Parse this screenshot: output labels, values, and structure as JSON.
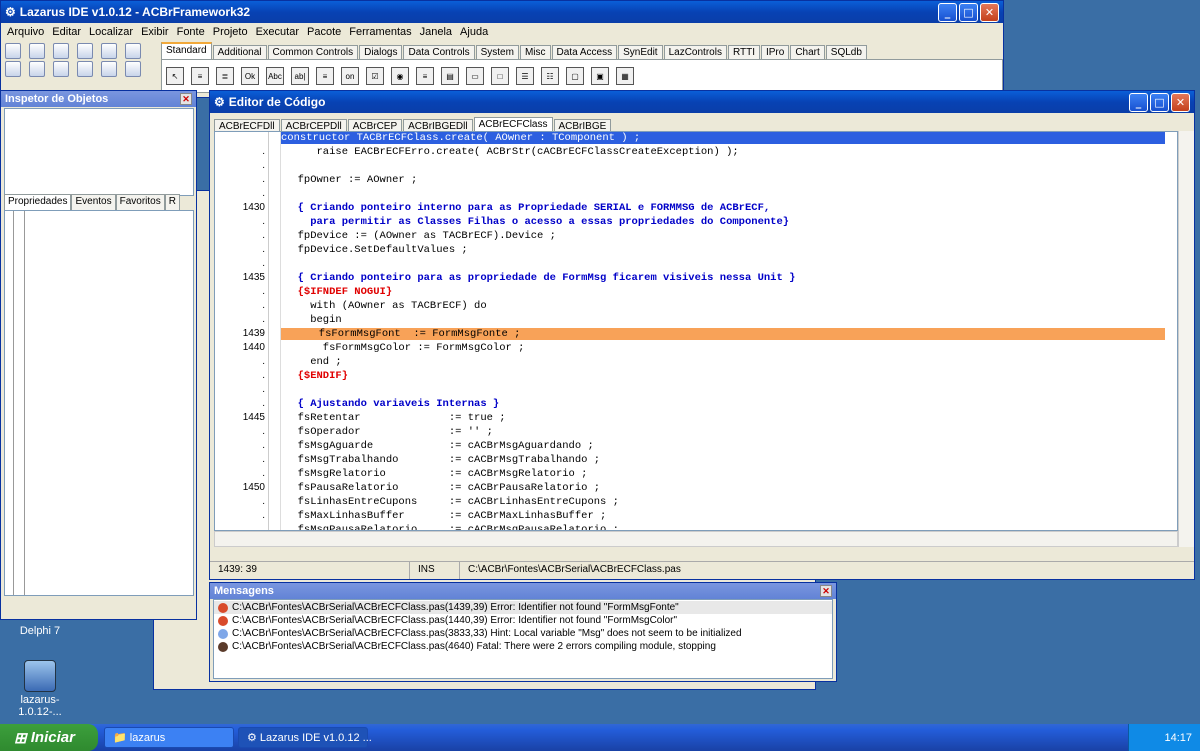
{
  "main_window": {
    "title": "Lazarus IDE v1.0.12 - ACBrFramework32",
    "menu": [
      "Arquivo",
      "Editar",
      "Localizar",
      "Exibir",
      "Fonte",
      "Projeto",
      "Executar",
      "Pacote",
      "Ferramentas",
      "Janela",
      "Ajuda"
    ],
    "palette_tabs": [
      "Standard",
      "Additional",
      "Common Controls",
      "Dialogs",
      "Data Controls",
      "System",
      "Misc",
      "Data Access",
      "SynEdit",
      "LazControls",
      "RTTI",
      "IPro",
      "Chart",
      "SQLdb"
    ],
    "active_palette_tab": "Standard"
  },
  "inspector": {
    "title": "Inspetor de Objetos",
    "tabs": [
      "Propriedades",
      "Eventos",
      "Favoritos",
      "R"
    ]
  },
  "desktop": {
    "icons": [
      {
        "label": "Delphi 7"
      },
      {
        "label": "lazarus-1.0.12-..."
      }
    ]
  },
  "editor": {
    "title": "Editor de Código",
    "tabs": [
      "ACBrECFDll",
      "ACBrCEPDll",
      "ACBrCEP",
      "ACBrIBGEDll",
      "ACBrECFClass",
      "ACBrIBGE"
    ],
    "active_tab": "ACBrECFClass",
    "lines": [
      {
        "n": "",
        "t": "constructor TACBrECFClass.create( AOwner : TComponent ) ;",
        "k": "sel"
      },
      {
        "n": ".",
        "t": "     raise EACBrECFErro.create( ACBrStr(cACBrECFClassCreateException) );",
        "k": ""
      },
      {
        "n": ".",
        "t": "",
        "k": ""
      },
      {
        "n": ".",
        "t": "  fpOwner := AOwner ;",
        "k": ""
      },
      {
        "n": ".",
        "t": "",
        "k": ""
      },
      {
        "n": "1430",
        "t": "  { Criando ponteiro interno para as Propriedade SERIAL e FORMMSG de ACBrECF,",
        "k": "cmt"
      },
      {
        "n": ".",
        "t": "    para permitir as Classes Filhas o acesso a essas propriedades do Componente}",
        "k": "cmt"
      },
      {
        "n": ".",
        "t": "  fpDevice := (AOwner as TACBrECF).Device ;",
        "k": ""
      },
      {
        "n": ".",
        "t": "  fpDevice.SetDefaultValues ;",
        "k": ""
      },
      {
        "n": ".",
        "t": "",
        "k": ""
      },
      {
        "n": "1435",
        "t": "  { Criando ponteiro para as propriedade de FormMsg ficarem visiveis nessa Unit }",
        "k": "cmt"
      },
      {
        "n": ".",
        "t": "  {$IFNDEF NOGUI}",
        "k": "dir"
      },
      {
        "n": ".",
        "t": "    with (AOwner as TACBrECF) do",
        "k": ""
      },
      {
        "n": ".",
        "t": "    begin",
        "k": ""
      },
      {
        "n": "1439",
        "t": "      fsFormMsgFont  := FormMsgFonte ;",
        "k": "err"
      },
      {
        "n": "1440",
        "t": "      fsFormMsgColor := FormMsgColor ;",
        "k": ""
      },
      {
        "n": ".",
        "t": "    end ;",
        "k": ""
      },
      {
        "n": ".",
        "t": "  {$ENDIF}",
        "k": "dir"
      },
      {
        "n": ".",
        "t": "",
        "k": ""
      },
      {
        "n": ".",
        "t": "  { Ajustando variaveis Internas }",
        "k": "cmt"
      },
      {
        "n": "1445",
        "t": "  fsRetentar              := true ;",
        "k": ""
      },
      {
        "n": ".",
        "t": "  fsOperador              := '' ;",
        "k": ""
      },
      {
        "n": ".",
        "t": "  fsMsgAguarde            := cACBrMsgAguardando ;",
        "k": ""
      },
      {
        "n": ".",
        "t": "  fsMsgTrabalhando        := cACBrMsgTrabalhando ;",
        "k": ""
      },
      {
        "n": ".",
        "t": "  fsMsgRelatorio          := cACBrMsgRelatorio ;",
        "k": ""
      },
      {
        "n": "1450",
        "t": "  fsPausaRelatorio        := cACBrPausaRelatorio ;",
        "k": ""
      },
      {
        "n": ".",
        "t": "  fsLinhasEntreCupons     := cACBrLinhasEntreCupons ;",
        "k": ""
      },
      {
        "n": ".",
        "t": "  fsMaxLinhasBuffer       := cACBrMaxLinhasBuffer ;",
        "k": ""
      },
      {
        "n": ".",
        "t": "  fsMsgPausaRelatorio     := cACBrMsgPausaRelatorio ;",
        "k": ""
      }
    ],
    "status": {
      "pos": "1439: 39",
      "mode": "INS",
      "file": "C:\\ACBr\\Fontes\\ACBrSerial\\ACBrECFClass.pas"
    }
  },
  "messages": {
    "title": "Mensagens",
    "items": [
      {
        "t": "C:\\ACBr\\Fontes\\ACBrSerial\\ACBrECFClass.pas(1439,39) Error: Identifier not found \"FormMsgFonte\"",
        "c": "#d94b2b"
      },
      {
        "t": "C:\\ACBr\\Fontes\\ACBrSerial\\ACBrECFClass.pas(1440,39) Error: Identifier not found \"FormMsgColor\"",
        "c": "#d94b2b"
      },
      {
        "t": "C:\\ACBr\\Fontes\\ACBrSerial\\ACBrECFClass.pas(3833,33) Hint: Local variable \"Msg\" does not seem to be initialized",
        "c": "#7fa7e8"
      },
      {
        "t": "C:\\ACBr\\Fontes\\ACBrSerial\\ACBrECFClass.pas(4640) Fatal: There were 2 errors compiling module, stopping",
        "c": "#5a3a2a"
      }
    ]
  },
  "taskbar": {
    "start": "Iniciar",
    "tasks": [
      "lazarus",
      "Lazarus IDE v1.0.12 ..."
    ],
    "clock": "14:17"
  }
}
